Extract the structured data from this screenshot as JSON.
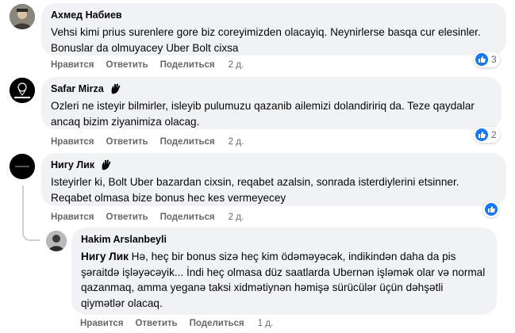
{
  "comments": [
    {
      "author": "Ахмед Набиев",
      "text": "Vehsi kimi prius surenlere gore biz coreyimizden olacayiq. Neynirlerse basqa cur elesinler. Bonuslar da olmuyacey Uber Bolt cixsa",
      "like_label": "Нравится",
      "reply_label": "Ответить",
      "share_label": "Поделиться",
      "time": "2 д.",
      "reaction_count": "3"
    },
    {
      "author": "Safar Mirza",
      "text": "Ozleri ne isteyir bilmirler, isleyib pulumuzu qazanib ailemizi dolandiririq da. Teze qaydalar ancaq bizim ziyanimiza olacag.",
      "like_label": "Нравится",
      "reply_label": "Ответить",
      "share_label": "Поделиться",
      "time": "2 д.",
      "reaction_count": "2"
    },
    {
      "author": "Нигу Лик",
      "text": "Isteyirler ki, Bolt Uber bazardan cixsin, reqabet azalsin, sonrada isterdiylerini etsinner. Reqabet olmasa bize bonus hec kes vermeyecey",
      "like_label": "Нравится",
      "reply_label": "Ответить",
      "share_label": "Поделиться",
      "time": "2 д.",
      "reaction_count": ""
    }
  ],
  "reply": {
    "author": "Hakim Arslanbeyli",
    "mention": "Нигу Лик",
    "text": " Hə, heç bir bonus sizə heç kim ödəməyəcək, indikindən daha da pis şəraitdə işləyəcəyik... İndi heç olmasa düz saatlarda Ubernən işləmək olar və normal qazanmaq, amma yeganə taksi xidmətiynən həmişə sürücülər üçün dəhşətli qiymətlər olacaq.",
    "like_label": "Нравится",
    "reply_label": "Ответить",
    "share_label": "Поделиться",
    "time": "1 д."
  },
  "colors": {
    "bubble": "#f0f2f5",
    "secondary_text": "#65676b",
    "like_blue": "#1877f2"
  },
  "icons": [
    "avatar",
    "top-fan-badge-icon",
    "like-icon"
  ]
}
